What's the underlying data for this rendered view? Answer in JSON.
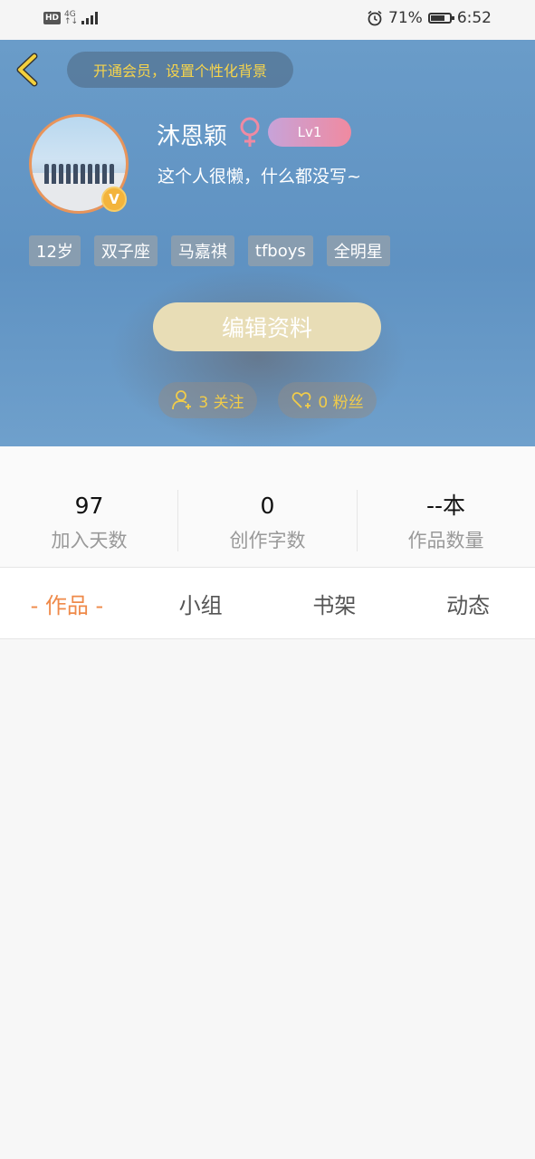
{
  "status_bar": {
    "hd": "HD",
    "network": "4G",
    "alarm_icon": "alarm-clock-icon",
    "battery_percent": "71%",
    "battery_level": 0.71,
    "time": "6:52"
  },
  "header": {
    "back_icon": "chevron-left-icon",
    "vip_banner": "开通会员，设置个性化背景",
    "username": "沐恩颖",
    "gender_icon": "female-symbol-icon",
    "level": "Lv1",
    "verified_badge": "V",
    "bio": "这个人很懒，什么都没写~",
    "tags": [
      "12岁",
      "双子座",
      "马嘉祺",
      "tfboys",
      "全明星"
    ],
    "edit_button": "编辑资料",
    "following_label": "3 关注",
    "followers_label": "0 粉丝",
    "colors": {
      "accent_yellow": "#f1cc4a",
      "level_gradient_start": "#c7a3d9",
      "level_gradient_end": "#f08aa0"
    }
  },
  "stats": [
    {
      "value": "97",
      "label": "加入天数"
    },
    {
      "value": "0",
      "label": "创作字数"
    },
    {
      "value": "--本",
      "label": "作品数量"
    }
  ],
  "tabs": [
    {
      "label": "- 作品 -",
      "active": true
    },
    {
      "label": "小组",
      "active": false
    },
    {
      "label": "书架",
      "active": false
    },
    {
      "label": "动态",
      "active": false
    }
  ],
  "active_tab_color": "#ef8a4a"
}
